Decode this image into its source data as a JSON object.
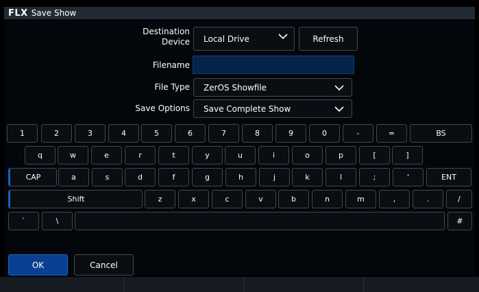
{
  "window": {
    "logo": "FLX",
    "title": "Save Show"
  },
  "form": {
    "destination_label_line1": "Destination",
    "destination_label_line2": "Device",
    "destination_value": "Local Drive",
    "refresh_label": "Refresh",
    "filename_label": "Filename",
    "filename_value": "",
    "file_type_label": "File Type",
    "file_type_value": "ZerOS Showfile",
    "save_options_label": "Save Options",
    "save_options_value": "Save Complete Show"
  },
  "keyboard": {
    "row1": [
      "1",
      "2",
      "3",
      "4",
      "5",
      "6",
      "7",
      "8",
      "9",
      "0",
      "-",
      "=",
      "BS"
    ],
    "row2": [
      "q",
      "w",
      "e",
      "r",
      "t",
      "y",
      "u",
      "i",
      "o",
      "p",
      "[",
      "]"
    ],
    "row3": [
      "CAP",
      "a",
      "s",
      "d",
      "f",
      "g",
      "h",
      "j",
      "k",
      "l",
      ";",
      "'",
      "ENT"
    ],
    "row4": [
      "Shift",
      "z",
      "x",
      "c",
      "v",
      "b",
      "n",
      "m",
      ",",
      ".",
      "/"
    ],
    "row5": [
      "`",
      "\\",
      "",
      "#"
    ]
  },
  "actions": {
    "ok_label": "OK",
    "cancel_label": "Cancel"
  },
  "colors": {
    "accent": "#0a3f92",
    "field": "#07234a",
    "background": "#03060b"
  },
  "icons": {
    "dropdown": "chevron-down-icon"
  }
}
